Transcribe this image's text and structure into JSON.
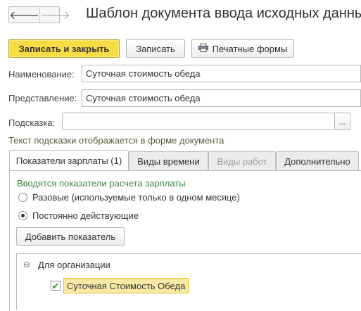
{
  "nav": {
    "back": "🡐",
    "forward": "🡒"
  },
  "window": {
    "title": "Шаблон документа ввода исходных данных"
  },
  "toolbar": {
    "save_close": "Записать и закрыть",
    "save": "Записать",
    "print_forms": "Печатные формы"
  },
  "form": {
    "name_label": "Наименование:",
    "name_value": "Суточная стоимость обеда",
    "presentation_label": "Представление:",
    "presentation_value": "Суточная стоимость обеда",
    "hint_label": "Подсказка:",
    "hint_value": "",
    "hint_button": "...",
    "hint_note": "Текст подсказки отображается в форме документа"
  },
  "tabs": [
    {
      "label": "Показатели зарплаты (1)",
      "state": "active"
    },
    {
      "label": "Виды времени",
      "state": "normal"
    },
    {
      "label": "Виды работ",
      "state": "disabled"
    },
    {
      "label": "Дополнительно",
      "state": "normal"
    }
  ],
  "panel": {
    "section_label": "Вводятся показатели расчета зарплаты",
    "options": [
      {
        "label": "Разовые (используемые только в одном месяце)",
        "selected": false
      },
      {
        "label": "Постоянно действующие",
        "selected": true
      }
    ],
    "add_button": "Добавить показатель",
    "tree": {
      "group_label": "Для организации",
      "collapse_glyph": "⊖",
      "item_label": "Суточная Стоимость Обеда",
      "item_checked": true,
      "check_glyph": "✔"
    }
  },
  "colors": {
    "accent_button": "#f7dc45",
    "hint_green": "#3a8a3a",
    "check_green": "#2f8f2f"
  }
}
